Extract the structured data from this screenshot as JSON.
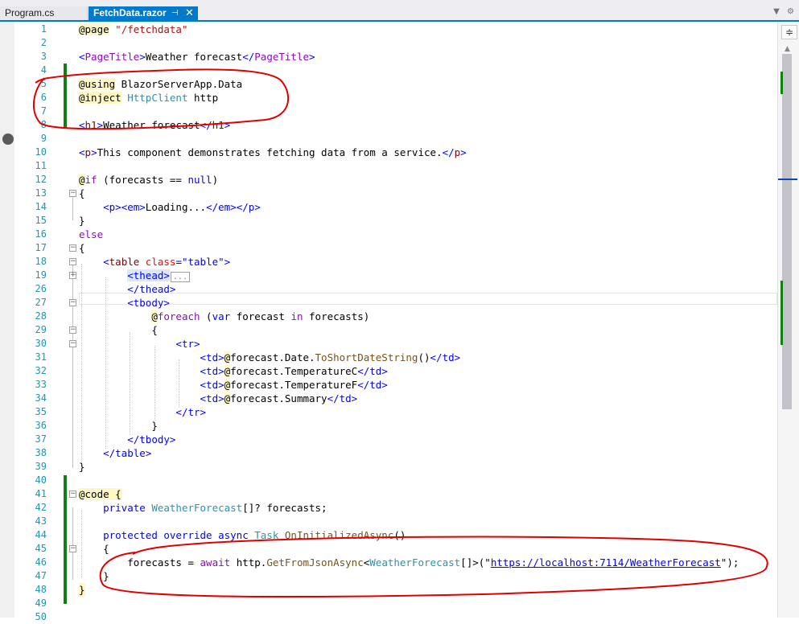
{
  "tabs": [
    {
      "label": "Program.cs",
      "active": false
    },
    {
      "label": "FetchData.razor",
      "active": true
    }
  ],
  "tab_icons": {
    "pin": "pin-icon",
    "close": "close-icon"
  },
  "tab_tools": {
    "dropdown": "chevron-down-icon",
    "settings": "gear-icon"
  },
  "line_numbers": [
    "1",
    "2",
    "3",
    "4",
    "5",
    "6",
    "7",
    "8",
    "9",
    "10",
    "11",
    "12",
    "13",
    "14",
    "15",
    "16",
    "17",
    "18",
    "19",
    "26",
    "27",
    "28",
    "29",
    "30",
    "31",
    "32",
    "33",
    "34",
    "35",
    "36",
    "37",
    "38",
    "39",
    "40",
    "41",
    "42",
    "43",
    "44",
    "45",
    "46",
    "47",
    "48",
    "49",
    "50"
  ],
  "code": {
    "l1": {
      "razor": "@page",
      "str": " \"/fetchdata\""
    },
    "l3": {
      "open": "<",
      "tag": "PageTitle",
      "close": ">",
      "text": "Weather forecast",
      "open2": "</",
      "tag2": "PageTitle",
      "close2": ">"
    },
    "l5": {
      "razor": "@using",
      "text": " BlazorServerApp.Data"
    },
    "l6": {
      "razor": "@inject",
      "type": " HttpClient",
      "text": " http"
    },
    "l8": {
      "open": "<",
      "tag": "h1",
      "close": ">",
      "text": "Weather forecast",
      "open2": "</",
      "tag2": "h1",
      "close2": ">"
    },
    "l10": {
      "open": "<",
      "tag": "p",
      "close": ">",
      "text": "This component demonstrates fetching data from a service.",
      "open2": "</",
      "tag2": "p",
      "close2": ">"
    },
    "l12": {
      "razor": "@",
      "kw": "if",
      "text": " (forecasts == ",
      "kw2": "null",
      "text2": ")"
    },
    "l13": "{",
    "l14": {
      "indent": "    ",
      "t1": "<p>",
      "t2": "<em>",
      "text": "Loading...",
      "t3": "</em>",
      "t4": "</p>"
    },
    "l15": "}",
    "l16": "else",
    "l17": "{",
    "l18": {
      "indent": "    ",
      "open": "<",
      "tag": "table",
      "attr": " class",
      "eq": "=",
      "val": "\"table\"",
      "close": ">"
    },
    "l19": {
      "indent": "        ",
      "tag": "<thead>",
      "collapsed": "..."
    },
    "l26": {
      "indent": "        ",
      "tag": "</thead>"
    },
    "l27": {
      "indent": "        ",
      "tag": "<tbody>"
    },
    "l28": {
      "indent": "            ",
      "razor": "@",
      "kw": "foreach",
      "p1": " (",
      "kw2": "var",
      "text": " forecast ",
      "kw3": "in",
      "text2": " forecasts)"
    },
    "l29": {
      "indent": "            ",
      "text": "{"
    },
    "l30": {
      "indent": "                ",
      "tag": "<tr>"
    },
    "l31": {
      "indent": "                    ",
      "t1": "<td>",
      "razor": "@",
      "text": "forecast.Date.",
      "meth": "ToShortDateString",
      "text2": "()",
      "t2": "</td>"
    },
    "l32": {
      "indent": "                    ",
      "t1": "<td>",
      "razor": "@",
      "text": "forecast.TemperatureC",
      "t2": "</td>"
    },
    "l33": {
      "indent": "                    ",
      "t1": "<td>",
      "razor": "@",
      "text": "forecast.TemperatureF",
      "t2": "</td>"
    },
    "l34": {
      "indent": "                    ",
      "t1": "<td>",
      "razor": "@",
      "text": "forecast.Summary",
      "t2": "</td>"
    },
    "l35": {
      "indent": "                ",
      "tag": "</tr>"
    },
    "l36": {
      "indent": "            ",
      "text": "}"
    },
    "l37": {
      "indent": "        ",
      "tag": "</tbody>"
    },
    "l38": {
      "indent": "    ",
      "tag": "</table>"
    },
    "l39": "}",
    "l41": {
      "razor": "@code",
      "text": " {"
    },
    "l42": {
      "indent": "    ",
      "kw": "private",
      "type": " WeatherForecast",
      "text": "[]? forecasts;"
    },
    "l44": {
      "indent": "    ",
      "kw": "protected override async",
      "type": " Task",
      "meth": " OnInitializedAsync",
      "text": "()"
    },
    "l45": {
      "indent": "    ",
      "text": "{"
    },
    "l46": {
      "indent": "        ",
      "text": "forecasts = ",
      "kw": "await",
      "text2": " http.",
      "meth": "GetFromJsonAsync",
      "p1": "<",
      "type": "WeatherForecast",
      "p2": "[]>(\"",
      "url": "https://localhost:7114/WeatherForecast",
      "p3": "\");"
    },
    "l47": {
      "indent": "    ",
      "text": "}"
    },
    "l48": "}"
  },
  "colors": {
    "accent": "#007acc",
    "change_bar": "#108010",
    "line_number": "#2b91af",
    "annotation": "#e00000"
  }
}
